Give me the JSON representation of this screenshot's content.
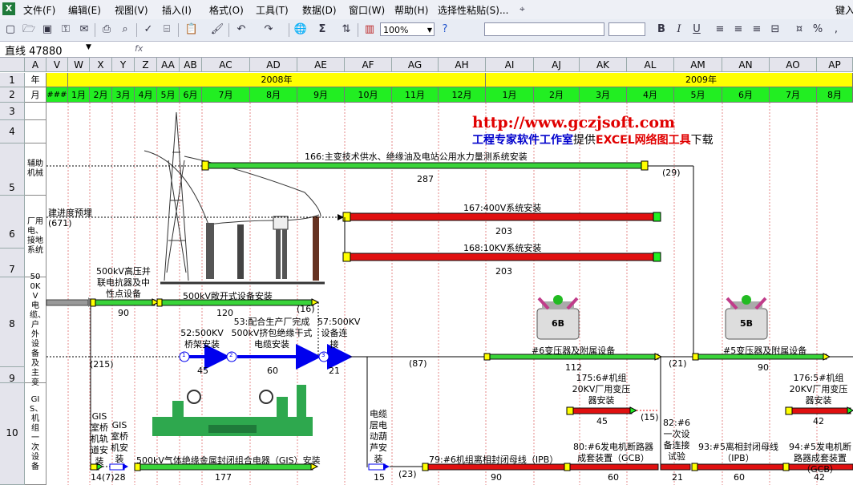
{
  "menu": [
    "文件(F)",
    "编辑(E)",
    "视图(V)",
    "插入(I)",
    "格式(O)",
    "工具(T)",
    "数据(D)",
    "窗口(W)",
    "帮助(H)",
    "选择性粘贴(S)..."
  ],
  "menu_right": "键入",
  "toolbar": {
    "zoom": "100%",
    "sigma": "Σ"
  },
  "formula": {
    "namebox": "直线 47880",
    "fx": "fx"
  },
  "columns": [
    "A",
    "V",
    "W",
    "X",
    "Y",
    "Z",
    "AA",
    "AB",
    "AC",
    "AD",
    "AE",
    "AF",
    "AG",
    "AH",
    "AI",
    "AJ",
    "AK",
    "AL",
    "AM",
    "AN",
    "AO",
    "AP"
  ],
  "rows": [
    "1",
    "2",
    "3",
    "4",
    "5",
    "6",
    "7",
    "8",
    "9",
    "10"
  ],
  "row1_label": "年",
  "row2_label": "月",
  "years": {
    "y2008": "2008年",
    "y2009": "2009年"
  },
  "months": [
    "###",
    "1月",
    "2月",
    "3月",
    "4月",
    "5月",
    "6月",
    "7月",
    "8月",
    "9月",
    "10月",
    "11月",
    "12月",
    "1月",
    "2月",
    "3月",
    "4月",
    "5月",
    "6月",
    "7月",
    "8月"
  ],
  "categories": {
    "aux": "辅助机械",
    "plant": "厂用电、接地系统",
    "kv500": "500KV电缆、户外设备及主变",
    "gis": "GIS、机组一次设备"
  },
  "header": {
    "url": "http://www.gczjsoft.com",
    "line2_a": "工程专家软件工作室",
    "line2_b": "提供",
    "line2_c": "EXCEL网络图工具",
    "line2_d": "下载"
  },
  "tasks": {
    "t166": "166:主变技术供水、绝缘油及电站公用水力量测系统安装",
    "d287": "287",
    "n29": "(29)",
    "pre": "建进度预埋",
    "n671": "(671)",
    "t167": "167:400V系统安装",
    "d203a": "203",
    "t168": "168:10KV系统安装",
    "d203b": "203",
    "t500reactor": "500kV高压并联电抗器及中性点设备",
    "d90a": "90",
    "t500open": "500kV敞开式设备安装",
    "d120": "120",
    "n16": "(16)",
    "t52": "52:500KV桥架安装",
    "d45a": "45",
    "t53": "53:配合生产厂完成500kV挤包绝缘干式电缆安装",
    "d60a": "60",
    "t57": "57:500KV设备连接",
    "d21a": "21",
    "n215": "(215)",
    "n87": "(87)",
    "t6b": "#6变压器及附属设备",
    "d112": "112",
    "n21": "(21)",
    "t5b": "#5变压器及附属设备",
    "d90b": "90",
    "b6": "6B",
    "b5": "5B",
    "t175": "175:6#机组20KV厂用变压器安装",
    "d45b": "45",
    "n15": "(15)",
    "t176": "176:5#机组20KV厂用变压器安装",
    "d42a": "42",
    "t82": "82:#6一次设备连接试验",
    "d21b": "21",
    "tgisrail": "GIS室桥机轨道安装",
    "tgiscrane": "GIS室桥机安装",
    "d14": "14",
    "n7": "(7)",
    "d28": "28",
    "tgis": "500kV气体绝缘金属封闭组合电器（GIS）安装",
    "d177": "177",
    "thoist": "电缆层电动葫芦安装",
    "d15": "15",
    "n23": "(23)",
    "t79": "79:#6机组离相封闭母线（IPB）",
    "d90c": "90",
    "t80": "80:#6发电机断路器成套装置（GCB）",
    "d60b": "60",
    "t93": "93:#5离相封闭母线（IPB）",
    "d60c": "60",
    "t94": "94:#5发电机断路器成套装置（GCB）",
    "d42b": "42",
    "node1": "1",
    "node2": "2",
    "node3": "3"
  },
  "colors": {
    "green": "#22ee22",
    "yellow": "#ffff00",
    "red": "#e01010",
    "blue": "#0000ee",
    "barGreen": "#39d439",
    "url": "#e00000",
    "linkBlue": "#0000cc"
  }
}
